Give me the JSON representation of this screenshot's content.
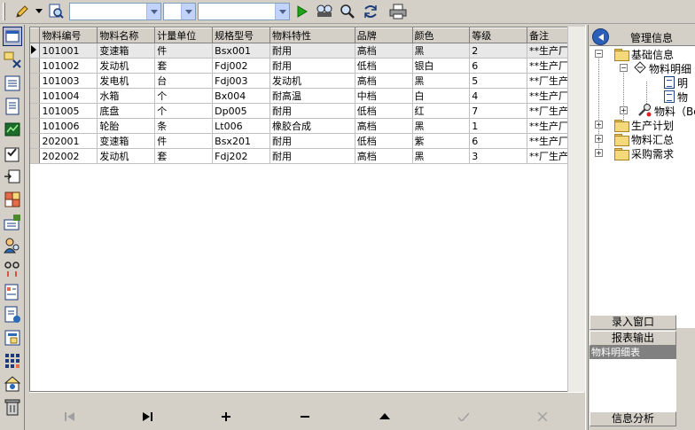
{
  "toolbar": {
    "tools": [
      "edit-pencil-icon",
      "dropdown-chevron-icon",
      "search-doc-icon"
    ],
    "combos": [
      {
        "value": ""
      },
      {
        "value": ""
      },
      {
        "value": ""
      }
    ],
    "actions": [
      "run-icon",
      "find-icon",
      "find-next-icon",
      "replace-icon",
      "print-icon"
    ],
    "colors": {
      "run": "#1fa319"
    }
  },
  "leftbar": {
    "icons": [
      "window-icon",
      "tools-icon",
      "list-view-icon",
      "document-icon",
      "chart-icon",
      "checklist-icon",
      "import-icon",
      "grid-icon",
      "config-icon",
      "users-icon",
      "links-icon",
      "report-icon",
      "export-doc-icon",
      "form-icon",
      "table-grid-icon",
      "settings-icon",
      "trash-icon"
    ]
  },
  "grid": {
    "columns": [
      "物料编号",
      "物料名称",
      "计量单位",
      "规格型号",
      "物料特性",
      "品牌",
      "颜色",
      "等级",
      "备注"
    ],
    "rows": [
      [
        "101001",
        "变速箱",
        "件",
        "Bsx001",
        "耐用",
        "高档",
        "黑",
        "2",
        "**生产厂家"
      ],
      [
        "101002",
        "发动机",
        "套",
        "Fdj002",
        "耐用",
        "低档",
        "银白",
        "6",
        "**生产厂家"
      ],
      [
        "101003",
        "发电机",
        "台",
        "Fdj003",
        "发动机",
        "高档",
        "黑",
        "5",
        "**厂生产"
      ],
      [
        "101004",
        "水箱",
        "个",
        "Bx004",
        "耐高温",
        "中档",
        "白",
        "4",
        "**生产厂家"
      ],
      [
        "101005",
        "底盘",
        "个",
        "Dp005",
        "耐用",
        "低档",
        "红",
        "7",
        "**厂生产"
      ],
      [
        "101006",
        "轮胎",
        "条",
        "Lt006",
        "橡胶合成",
        "高档",
        "黑",
        "1",
        "**生产厂家"
      ],
      [
        "202001",
        "变速箱",
        "件",
        "Bsx201",
        "耐用",
        "低档",
        "紫",
        "6",
        "**生产厂家"
      ],
      [
        "202002",
        "发动机",
        "套",
        "Fdj202",
        "耐用",
        "高档",
        "黑",
        "3",
        "**厂生产"
      ]
    ],
    "selected_row": 0
  },
  "navigator": {
    "buttons": [
      {
        "name": "first-record-icon",
        "glyph": "|◄",
        "enabled": false
      },
      {
        "name": "last-record-icon",
        "glyph": "►|",
        "enabled": true
      },
      {
        "name": "add-record-icon",
        "glyph": "+",
        "enabled": true
      },
      {
        "name": "delete-record-icon",
        "glyph": "−",
        "enabled": true
      },
      {
        "name": "edit-record-icon",
        "glyph": "▲",
        "enabled": true
      },
      {
        "name": "post-record-icon",
        "glyph": "✓",
        "enabled": false
      },
      {
        "name": "cancel-record-icon",
        "glyph": "✕",
        "enabled": false
      }
    ]
  },
  "right_panel": {
    "title": "管理信息",
    "tree": [
      {
        "label": "基础信息",
        "level": 0,
        "expander": "−"
      },
      {
        "label": "物料明细",
        "level": 1,
        "expander": "−"
      },
      {
        "label": "明",
        "level": 2
      },
      {
        "label": "物",
        "level": 2
      },
      {
        "label": "物料（Bo",
        "level": 1,
        "expander": "+"
      },
      {
        "label": "生产计划",
        "level": 0,
        "expander": "+"
      },
      {
        "label": "物料汇总",
        "level": 0,
        "expander": "+"
      },
      {
        "label": "采购需求",
        "level": 0,
        "expander": "+"
      }
    ],
    "buttons": {
      "entry_window": "录入窗口",
      "report_output": "报表输出",
      "info_analysis": "信息分析"
    },
    "report_list": [
      "物料明细表"
    ]
  }
}
